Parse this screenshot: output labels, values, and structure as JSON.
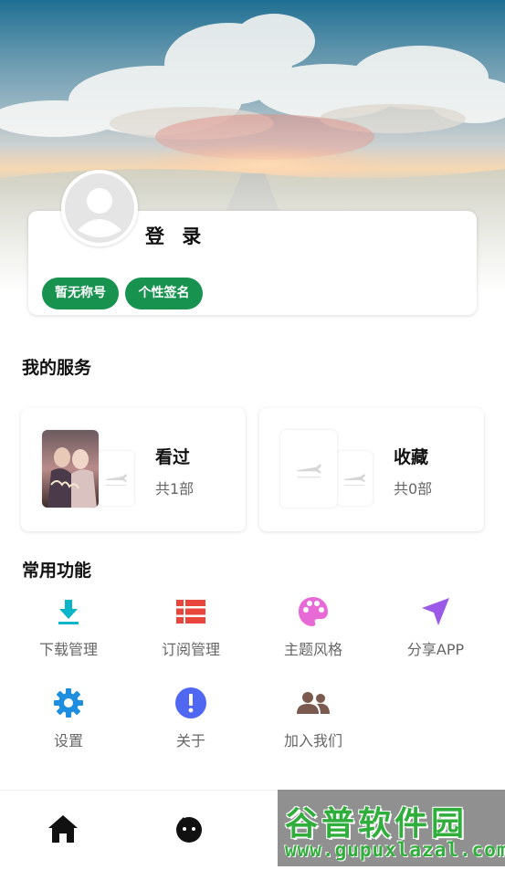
{
  "colors": {
    "tag_green": "#17924f",
    "download_teal": "#0bb5c9",
    "subscribe_red": "#e8463b",
    "theme_pink": "#e86ad6",
    "share_purple": "#9b59e8",
    "settings_blue": "#1e8fe0",
    "about_indigo": "#5067f2",
    "join_brown": "#7a5a4e"
  },
  "profile": {
    "login_label": "登 录",
    "tags": [
      "暂无称号",
      "个性签名"
    ]
  },
  "services": {
    "title": "我的服务",
    "cards": [
      {
        "name": "看过",
        "count": "共1部",
        "thumb_icon": "movie-poster-thumbnail"
      },
      {
        "name": "收藏",
        "count": "共0部",
        "thumb_icon": "airplane-placeholder-icon"
      }
    ]
  },
  "functions": {
    "title": "常用功能",
    "items": [
      {
        "label": "下载管理",
        "icon": "download-icon"
      },
      {
        "label": "订阅管理",
        "icon": "list-icon"
      },
      {
        "label": "主题风格",
        "icon": "palette-icon"
      },
      {
        "label": "分享APP",
        "icon": "send-icon"
      },
      {
        "label": "设置",
        "icon": "gear-icon"
      },
      {
        "label": "关于",
        "icon": "info-icon"
      },
      {
        "label": "加入我们",
        "icon": "group-icon"
      }
    ]
  },
  "bottom_nav": {
    "items": [
      {
        "icon": "home-icon"
      },
      {
        "icon": "discover-face-icon"
      }
    ]
  },
  "watermark": {
    "title": "谷普软件园",
    "url": "www.gupuxlazal.com"
  }
}
